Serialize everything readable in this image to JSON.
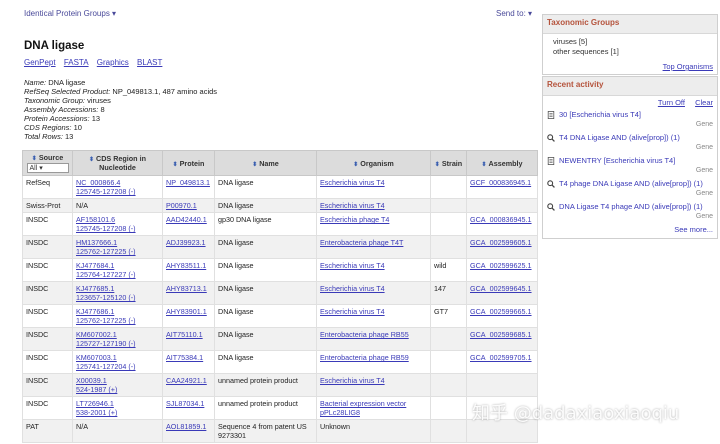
{
  "header": {
    "database": "Identical Protein Groups ▾",
    "send_to": "Send to: ▾"
  },
  "title": "DNA ligase",
  "formats": [
    "GenPept",
    "FASTA",
    "Graphics",
    "BLAST"
  ],
  "meta": [
    {
      "label": "Name:",
      "value": "DNA ligase"
    },
    {
      "label": "RefSeq Selected Product:",
      "value": "NP_049813.1, 487 amino acids"
    },
    {
      "label": "Taxonomic Group:",
      "value": "viruses"
    },
    {
      "label": "Assembly Accessions:",
      "value": "8"
    },
    {
      "label": "Protein Accessions:",
      "value": "13"
    },
    {
      "label": "CDS Regions:",
      "value": "10"
    },
    {
      "label": "Total Rows:",
      "value": "13"
    }
  ],
  "table": {
    "headers": {
      "source": "Source",
      "source_filter": "All",
      "cds": "CDS Region in Nucleotide",
      "protein": "Protein",
      "name": "Name",
      "organism": "Organism",
      "strain": "Strain",
      "assembly": "Assembly"
    },
    "rows": [
      {
        "source": "RefSeq",
        "cds1": "NC_000866.4",
        "cds2": "125745-127208 (-)",
        "protein": "NP_049813.1",
        "name": "DNA ligase",
        "organism": "Escherichia virus T4",
        "strain": "",
        "assembly": "GCF_000836945.1"
      },
      {
        "source": "Swiss-Prot",
        "cds1": "N/A",
        "cds2": "",
        "protein": "P00970.1",
        "name": "DNA ligase",
        "organism": "Escherichia virus T4",
        "strain": "",
        "assembly": ""
      },
      {
        "source": "INSDC",
        "cds1": "AF158101.6",
        "cds2": "125745-127208 (-)",
        "protein": "AAD42440.1",
        "name": "gp30 DNA ligase",
        "organism": "Escherichia phage T4",
        "strain": "",
        "assembly": "GCA_000836945.1"
      },
      {
        "source": "INSDC",
        "cds1": "HM137666.1",
        "cds2": "125762-127225 (-)",
        "protein": "ADJ39923.1",
        "name": "DNA ligase",
        "organism": "Enterobacteria phage T4T",
        "strain": "",
        "assembly": "GCA_002599605.1"
      },
      {
        "source": "INSDC",
        "cds1": "KJ477684.1",
        "cds2": "125764-127227 (-)",
        "protein": "AHY83511.1",
        "name": "DNA ligase",
        "organism": "Escherichia virus T4",
        "strain": "wild",
        "assembly": "GCA_002599625.1"
      },
      {
        "source": "INSDC",
        "cds1": "KJ477685.1",
        "cds2": "123657-125120 (-)",
        "protein": "AHY83713.1",
        "name": "DNA ligase",
        "organism": "Escherichia virus T4",
        "strain": "147",
        "assembly": "GCA_002599645.1"
      },
      {
        "source": "INSDC",
        "cds1": "KJ477686.1",
        "cds2": "125762-127225 (-)",
        "protein": "AHY83901.1",
        "name": "DNA ligase",
        "organism": "Escherichia virus T4",
        "strain": "GT7",
        "assembly": "GCA_002599665.1"
      },
      {
        "source": "INSDC",
        "cds1": "KM607002.1",
        "cds2": "125727-127190 (-)",
        "protein": "AIT75110.1",
        "name": "DNA ligase",
        "organism": "Enterobacteria phage RB55",
        "strain": "",
        "assembly": "GCA_002599685.1"
      },
      {
        "source": "INSDC",
        "cds1": "KM607003.1",
        "cds2": "125741-127204 (-)",
        "protein": "AIT75384.1",
        "name": "DNA ligase",
        "organism": "Enterobacteria phage RB59",
        "strain": "",
        "assembly": "GCA_002599705.1"
      },
      {
        "source": "INSDC",
        "cds1": "X00039.1",
        "cds2": "524-1987 (+)",
        "protein": "CAA24921.1",
        "name": "unnamed protein product",
        "organism": "Escherichia virus T4",
        "strain": "",
        "assembly": ""
      },
      {
        "source": "INSDC",
        "cds1": "LT726946.1",
        "cds2": "538-2001 (+)",
        "protein": "SJL87034.1",
        "name": "unnamed protein product",
        "organism": "Bacterial expression vector pPLc28LIG8",
        "strain": "",
        "assembly": ""
      },
      {
        "source": "PAT",
        "cds1": "N/A",
        "cds2": "",
        "protein": "AOL81859.1",
        "name": "Sequence 4 from patent US 9273301",
        "organism": "Unknown",
        "strain": "",
        "assembly": ""
      }
    ]
  },
  "taxonomic": {
    "title": "Taxonomic Groups",
    "item1": "viruses [5]",
    "item2": "other sequences [1]",
    "top_link": "Top Organisms"
  },
  "recent": {
    "title": "Recent activity",
    "turn_off": "Turn Off",
    "clear": "Clear",
    "items": [
      {
        "label": "30 [Escherichia virus T4]",
        "tag": "Gene",
        "icon": "document-icon"
      },
      {
        "label": "T4 DNA Ligase AND (alive[prop]) (1)",
        "tag": "Gene",
        "icon": "search-icon"
      },
      {
        "label": "NEWENTRY [Escherichia virus T4]",
        "tag": "Gene",
        "icon": "document-icon"
      },
      {
        "label": "T4 phage DNA Ligase AND (alive[prop]) (1)",
        "tag": "Gene",
        "icon": "search-icon"
      },
      {
        "label": "DNA Ligase T4 phage AND (alive[prop]) (1)",
        "tag": "Gene",
        "icon": "search-icon"
      }
    ],
    "see_more": "See more..."
  },
  "watermark": "知乎 @dadaxiaoxiaoqiu"
}
